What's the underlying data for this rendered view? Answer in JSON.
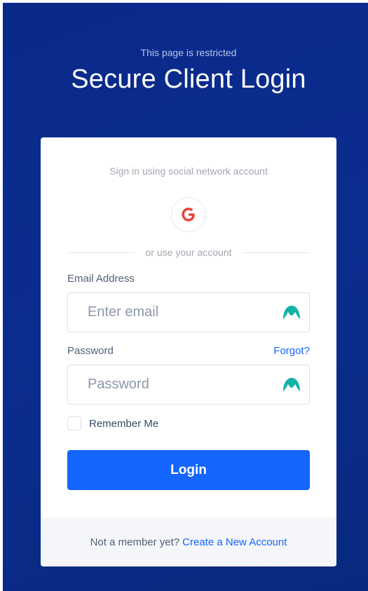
{
  "header": {
    "kicker": "This page is restricted",
    "title": "Secure Client Login"
  },
  "social": {
    "caption": "Sign in using social network account",
    "google_icon": "google-g-icon",
    "google_color": "#ea4335"
  },
  "divider_text": "or use your account",
  "email": {
    "label": "Email Address",
    "value": "",
    "placeholder": "Enter email",
    "icon": "password-manager-icon"
  },
  "password": {
    "label": "Password",
    "forgot_label": "Forgot?",
    "value": "",
    "placeholder": "Password",
    "icon": "password-manager-icon"
  },
  "remember": {
    "label": "Remember Me",
    "checked": false
  },
  "login_button": "Login",
  "footer": {
    "text": "Not a member yet?",
    "link": "Create a New Account"
  },
  "colors": {
    "background": "#0a2a8a",
    "accent": "#1565ff",
    "icon_teal": "#14b3a6"
  }
}
